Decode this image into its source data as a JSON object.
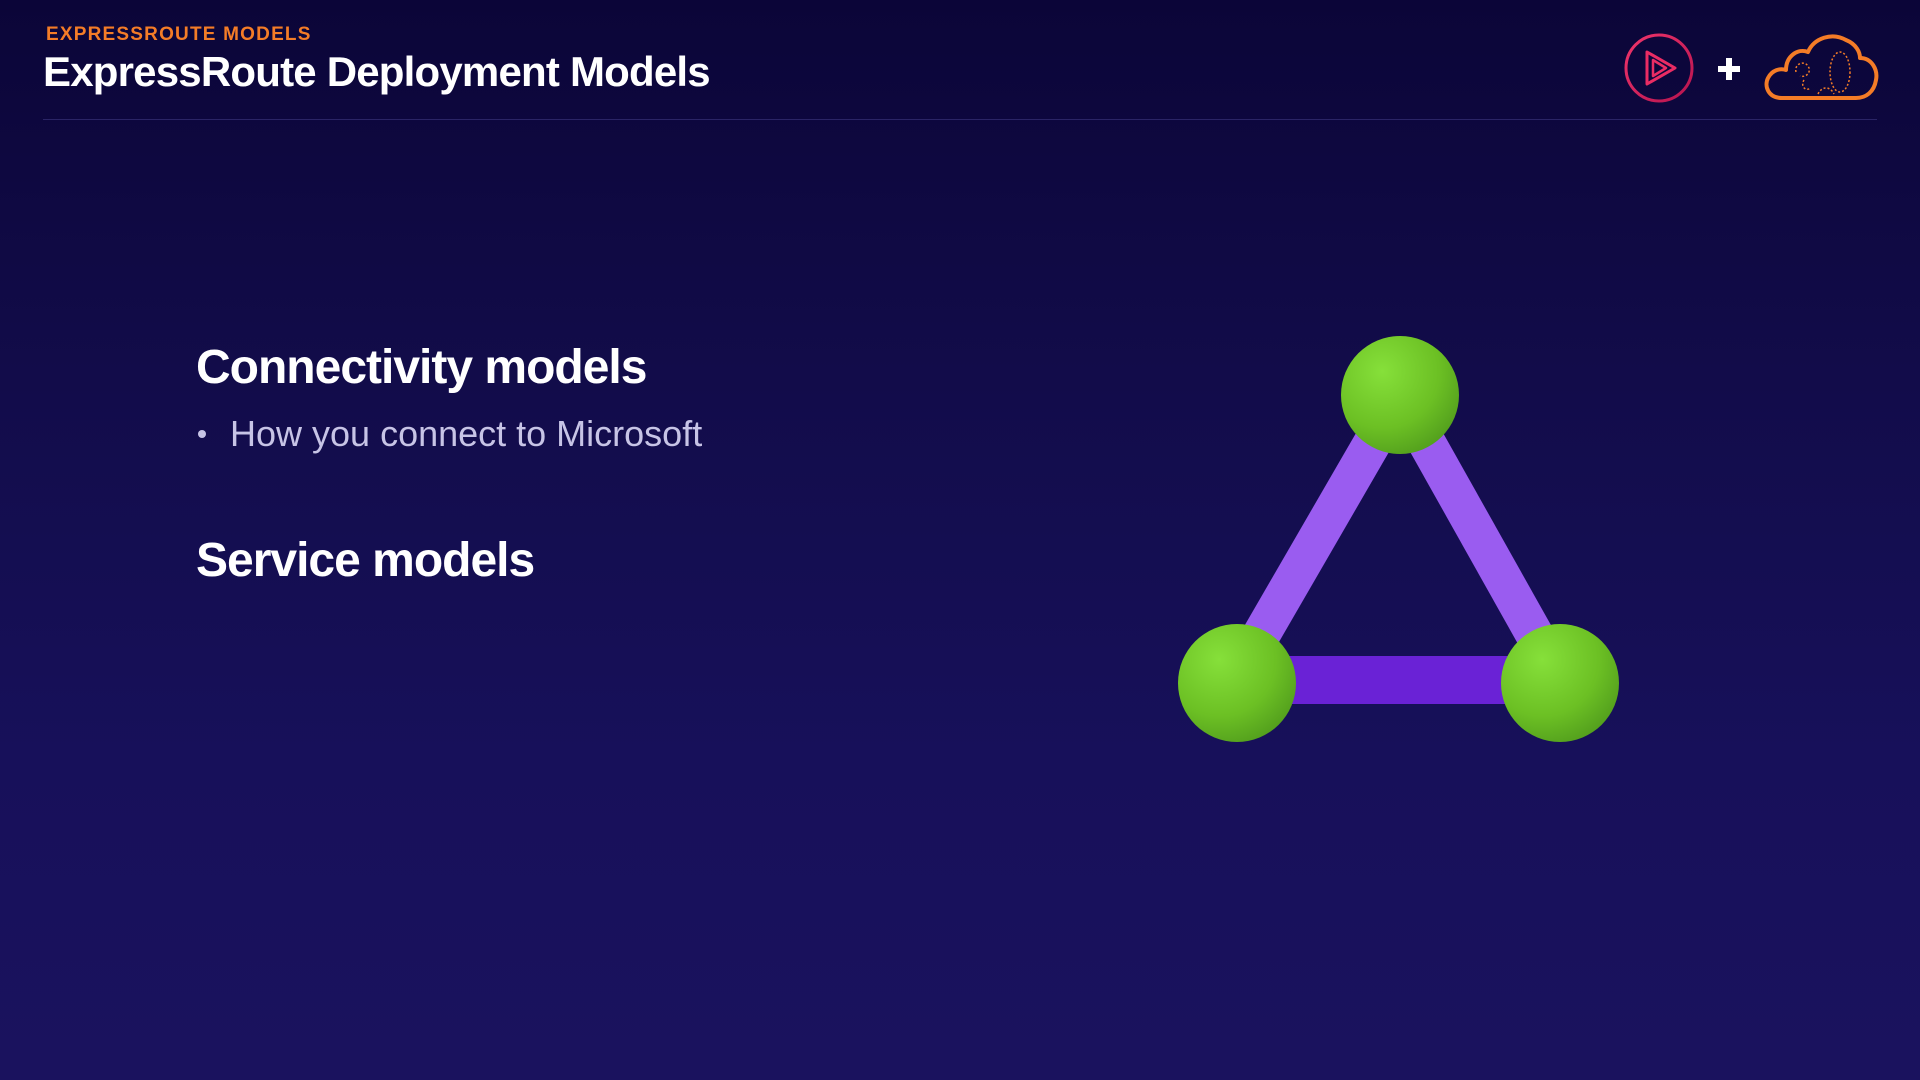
{
  "header": {
    "eyebrow": "EXPRESSROUTE MODELS",
    "title": "ExpressRoute Deployment Models",
    "plus_symbol": "+"
  },
  "logos": [
    {
      "icon": "play-circle-icon",
      "color": "#e0245e"
    },
    {
      "icon": "cloud-icon",
      "color": "#f47c27"
    }
  ],
  "sections": [
    {
      "heading": "Connectivity models",
      "bullets": [
        "How you connect to Microsoft"
      ]
    },
    {
      "heading": "Service models",
      "bullets": []
    }
  ],
  "diagram": {
    "icon": "network-triangle-icon",
    "node_color": "#7ed321",
    "edge_color": "#9a5cf0",
    "base_edge_color": "#6a22d6"
  }
}
